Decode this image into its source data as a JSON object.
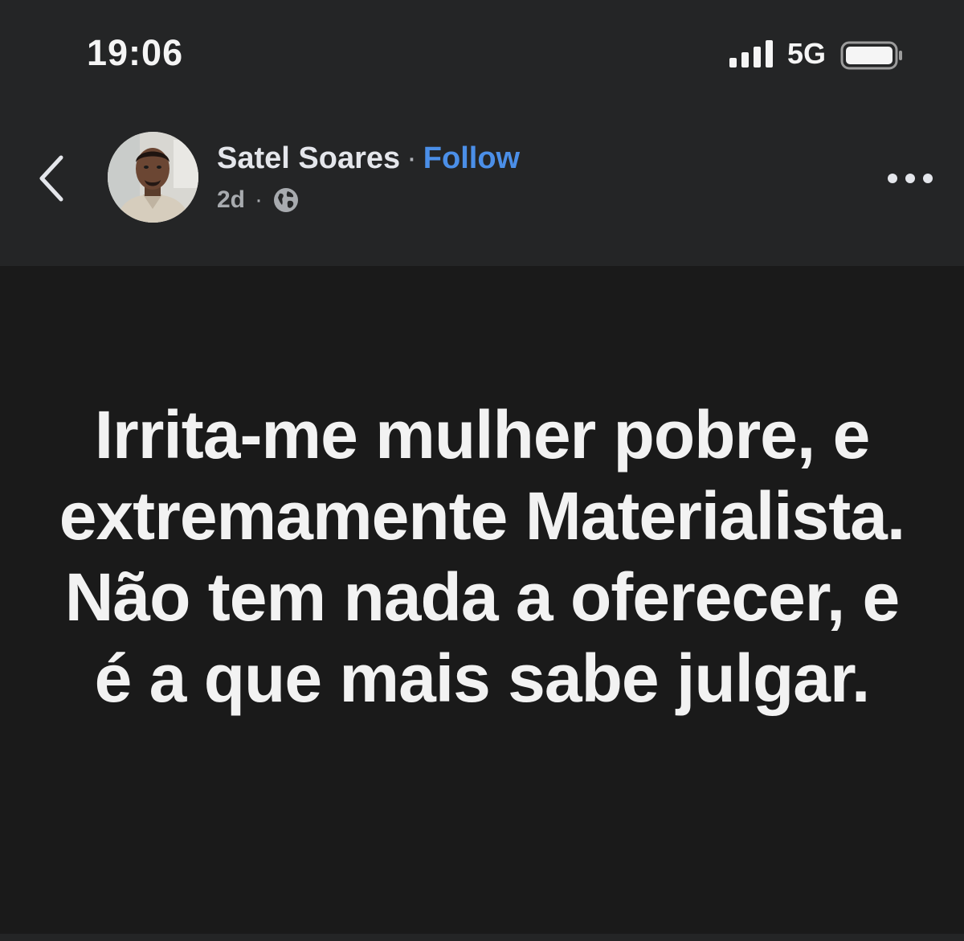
{
  "status_bar": {
    "time": "19:06",
    "network": "5G",
    "icons": [
      "signal-icon",
      "battery-icon"
    ]
  },
  "post": {
    "author": "Satel Soares",
    "separator": "·",
    "follow_label": "Follow",
    "timestamp": "2d",
    "meta_separator": "·",
    "audience_icon": "globe-icon",
    "text": "Irrita-me mulher pobre, e extremamente Materialista. Não tem nada a oferecer, e é a que mais sabe julgar."
  },
  "colors": {
    "header_bg": "#242526",
    "post_bg": "#1a1a1a",
    "follow_link": "#4b8fe8",
    "meta_text": "#a8abaf"
  }
}
